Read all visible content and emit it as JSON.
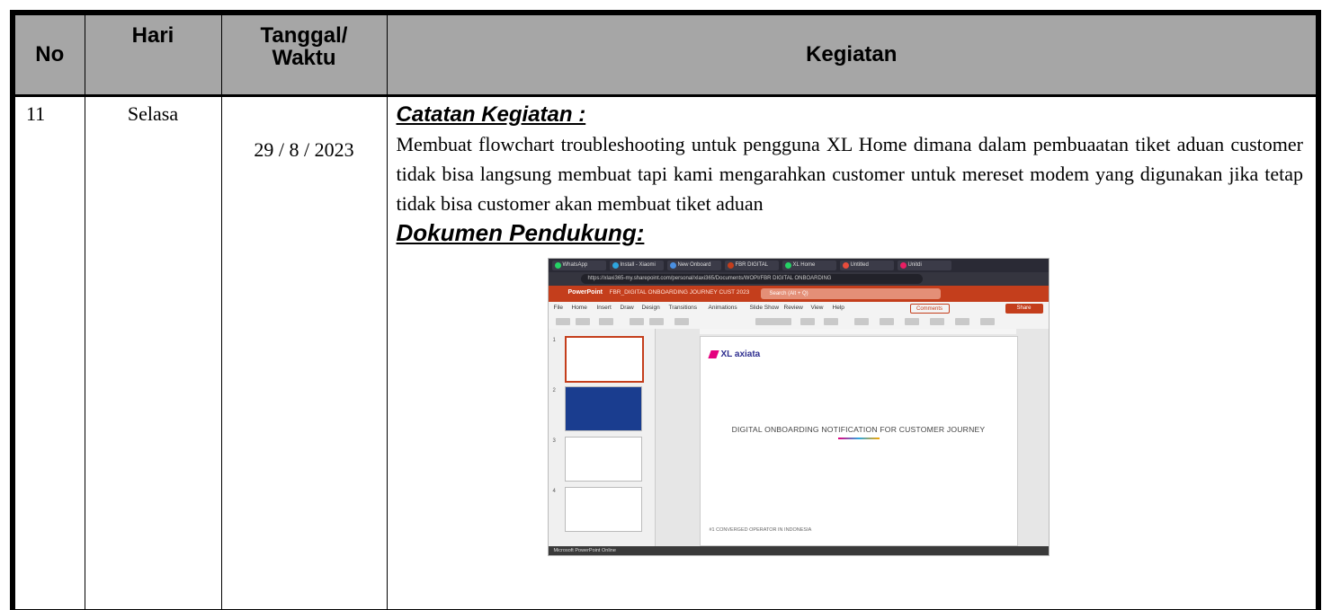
{
  "table": {
    "headers": {
      "no": "No",
      "hari": "Hari",
      "tanggal_line1": "Tanggal/",
      "tanggal_line2": "Waktu",
      "kegiatan": "Kegiatan"
    },
    "row": {
      "no": "11",
      "hari": "Selasa",
      "tanggal": "29 / 8 / 2023",
      "catatan_heading": "Catatan Kegiatan :",
      "catatan_text": "Membuat flowchart troubleshooting untuk pengguna XL Home dimana dalam pembuaatan tiket aduan customer tidak bisa langsung membuat tapi kami mengarahkan customer untuk mereset modem yang digunakan jika tetap tidak bisa customer akan membuat tiket aduan",
      "dokumen_heading": "Dokumen Pendukung:"
    }
  },
  "screenshot": {
    "tabs": [
      "WhatsApp",
      "Install - Xiaomi",
      "New Onboard",
      "FBR DIGITAL",
      "XL Home",
      "Untitled",
      "Unitdi"
    ],
    "url": "https://xlaxi365-my.sharepoint.com/personal/xlaxi365/Documents/WOPI/FBR DIGITAL ONBOARDING",
    "app_name": "PowerPoint",
    "file_name": "FBR_DIGITAL ONBOARDING JOURNEY CUST 2023",
    "search_placeholder": "Search (Alt + Q)",
    "ribbon_tabs": [
      "File",
      "Home",
      "Insert",
      "Draw",
      "Design",
      "Transitions",
      "Animations",
      "Slide Show",
      "Review",
      "View",
      "Help"
    ],
    "comments_label": "Comments",
    "share_label": "Share",
    "slide_logo": "XL axiata",
    "slide_title": "DIGITAL ONBOARDING NOTIFICATION FOR CUSTOMER JOURNEY",
    "slide_footer": "#1 CONVERGED OPERATOR IN INDONESIA",
    "thumb_numbers": [
      "1",
      "2",
      "3",
      "4"
    ],
    "status_text": "Microsoft PowerPoint Online",
    "colors": {
      "ppt_red": "#c43e1c",
      "header_gray": "#a6a6a6"
    }
  }
}
